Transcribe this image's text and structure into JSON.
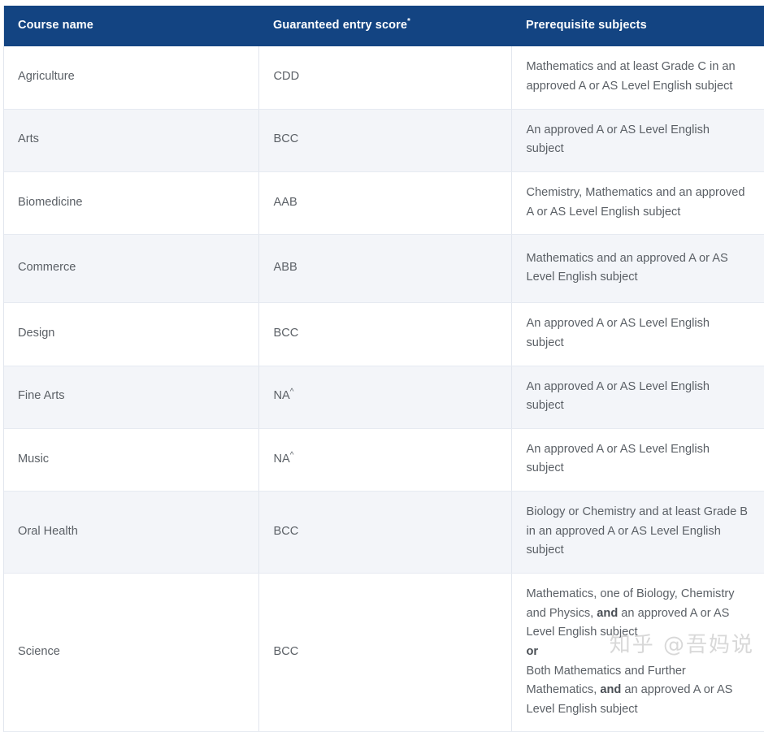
{
  "table": {
    "columns": [
      {
        "label": "Course name",
        "marker": ""
      },
      {
        "label": "Guaranteed entry score",
        "marker": "*"
      },
      {
        "label": "Prerequisite subjects",
        "marker": ""
      }
    ],
    "rows": [
      {
        "course": "Agriculture",
        "score": "CDD",
        "score_marker": "",
        "prerequisites": "Mathematics and at least Grade C in an approved A or AS Level English subject"
      },
      {
        "course": "Arts",
        "score": "BCC",
        "score_marker": "",
        "prerequisites": "An approved A or AS Level English subject"
      },
      {
        "course": "Biomedicine",
        "score": "AAB",
        "score_marker": "",
        "prerequisites": "Chemistry, Mathematics and an approved A or AS Level English subject"
      },
      {
        "course": "Commerce",
        "score": "ABB",
        "score_marker": "",
        "prerequisites": "Mathematics and an approved A or AS Level English subject"
      },
      {
        "course": "Design",
        "score": "BCC",
        "score_marker": "",
        "prerequisites": "An approved A or AS Level English subject"
      },
      {
        "course": "Fine Arts",
        "score": "NA",
        "score_marker": "^",
        "prerequisites": "An approved A or AS Level English subject"
      },
      {
        "course": "Music",
        "score": "NA",
        "score_marker": "^",
        "prerequisites": "An approved A or AS Level English subject"
      },
      {
        "course": "Oral Health",
        "score": "BCC",
        "score_marker": "",
        "prerequisites": "Biology or Chemistry and at least Grade B in an approved A or AS Level English subject"
      },
      {
        "course": "Science",
        "score": "BCC",
        "score_marker": "",
        "prerequisites_parts": {
          "line1_a": "Mathematics, one of Biology, Chemistry and Physics, ",
          "line1_b": "and",
          "line1_c": " an approved A or AS Level English subject",
          "connector": "or",
          "line2_a": "Both Mathematics and Further Mathematics, ",
          "line2_b": "and",
          "line2_c": " an approved A or AS Level English subject"
        }
      }
    ]
  },
  "watermark": {
    "text": "知乎 @吾妈说"
  },
  "colors": {
    "header_bg": "#134482",
    "header_text": "#ffffff",
    "row_alt_bg": "#f3f5f9",
    "row_bg": "#ffffff",
    "border": "#e6eaf1",
    "body_text": "#5b6066"
  }
}
